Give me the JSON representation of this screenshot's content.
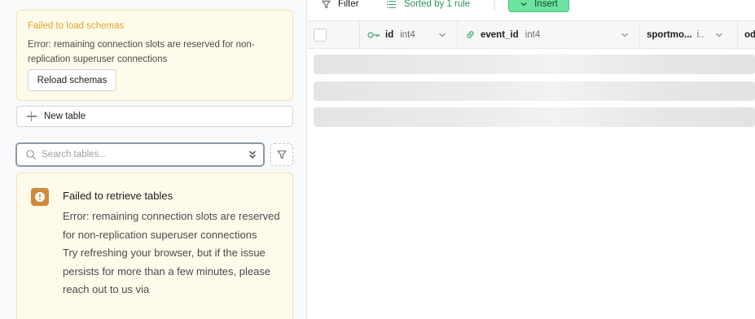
{
  "sidebar": {
    "schema_error": {
      "title": "Failed to load schemas",
      "message": "Error: remaining connection slots are reserved for non-replication superuser connections",
      "reload_label": "Reload schemas"
    },
    "new_table_label": "New table",
    "search": {
      "placeholder": "Search tables..."
    },
    "tables_error": {
      "title": "Failed to retrieve tables",
      "message_line1": "Error: remaining connection slots are reserved for non-replication superuser connections",
      "message_line2": "Try refreshing your browser, but if the issue persists for more than a few minutes, please reach out to us via"
    }
  },
  "toolbar": {
    "filter_label": "Filter",
    "sorted_label": "Sorted by 1 rule",
    "insert_label": "Insert"
  },
  "grid": {
    "columns": [
      {
        "name": "id",
        "type": "int4",
        "icon": "primary-key-icon"
      },
      {
        "name": "event_id",
        "type": "int4",
        "icon": "foreign-key-link-icon"
      },
      {
        "name": "sportmo...",
        "type": "i.."
      },
      {
        "name": "od"
      }
    ],
    "loading_rows": 3
  },
  "colors": {
    "warning_bg": "#fffbeb",
    "warning_title": "#e0a424",
    "error_icon": "#d1893b",
    "sort_green": "#27915f",
    "insert_green": "#6ee29f"
  }
}
